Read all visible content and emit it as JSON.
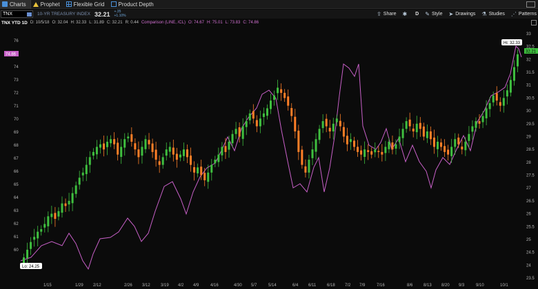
{
  "tabs": [
    {
      "label": "Charts",
      "icon": "charts-icon",
      "active": true
    },
    {
      "label": "Prophet",
      "icon": "prophet-icon",
      "active": false
    },
    {
      "label": "Flexible Grid",
      "icon": "grid-icon",
      "active": false
    },
    {
      "label": "Product Depth",
      "icon": "depth-icon",
      "active": false
    }
  ],
  "toolbar": {
    "symbol": "TNX",
    "description": "10-YR TREASURY INDEX",
    "last": "32.21",
    "change": "+.35",
    "change_pct": "+1.10%",
    "share_label": "Share",
    "aggregation": "D",
    "style_label": "Style",
    "drawings_label": "Drawings",
    "studies_label": "Studies",
    "patterns_label": "Patterns"
  },
  "chart_header": {
    "title": "TNX YTD 1D",
    "date": "D: 10/5/18",
    "open": "O: 32.04",
    "high": "H: 32.33",
    "low": "L: 31.89",
    "close": "C: 32.21",
    "range": "R: 0.44",
    "comparison_label": "Comparison (LINE, /CL)",
    "cmp_open": "O: 74.67",
    "cmp_high": "H: 75.01",
    "cmp_low": "L: 73.83",
    "cmp_close": "C: 74.86"
  },
  "chart_data": {
    "type": "candlestick",
    "x_ticks": [
      "1/15",
      "1/29",
      "2/12",
      "2/26",
      "3/12",
      "3/19",
      "4/2",
      "4/9",
      "4/16",
      "4/30",
      "5/7",
      "5/14",
      "6/4",
      "6/11",
      "6/18",
      "7/2",
      "7/9",
      "7/16",
      "8/6",
      "8/13",
      "8/20",
      "9/3",
      "9/10",
      "10/1"
    ],
    "right_axis": {
      "label": "TNX",
      "ticks": [
        "33",
        "32.5",
        "32",
        "31.5",
        "31",
        "30.5",
        "30",
        "29.5",
        "29",
        "28.5",
        "28",
        "27.5",
        "27",
        "26.5",
        "26",
        "25.5",
        "25",
        "24.5",
        "24",
        "23.5"
      ],
      "ylim": [
        23.5,
        33
      ]
    },
    "left_axis": {
      "label": "/CL",
      "ticks": [
        "76",
        "75",
        "74",
        "73",
        "72",
        "71",
        "70",
        "69",
        "68",
        "67",
        "66",
        "65",
        "64",
        "63",
        "62",
        "61",
        "60"
      ],
      "ylim": [
        59,
        76
      ]
    },
    "hi_label": "Hi: 32.33",
    "lo_label": "Lo: 24.25",
    "last_price_tag": "32.21",
    "cmp_price_tag": "74.86",
    "up_color": "#3fbf3f",
    "down_color": "#ff7f27",
    "comparison_color": "#c860c8",
    "tnx_close": [
      24.3,
      24.6,
      24.9,
      25.1,
      25.3,
      25.4,
      25.6,
      25.9,
      26.0,
      25.8,
      26.1,
      26.4,
      26.3,
      26.5,
      26.8,
      27.1,
      27.4,
      27.6,
      27.9,
      28.2,
      28.4,
      28.6,
      28.7,
      28.5,
      28.8,
      28.9,
      28.7,
      28.3,
      28.6,
      28.9,
      29.0,
      28.8,
      28.5,
      28.2,
      28.6,
      28.9,
      28.7,
      28.4,
      28.1,
      27.9,
      28.2,
      28.5,
      28.6,
      28.3,
      28.1,
      28.3,
      28.5,
      28.2,
      27.9,
      27.6,
      27.8,
      27.5,
      27.3,
      27.6,
      27.9,
      28.1,
      28.3,
      28.6,
      28.4,
      28.8,
      29.1,
      29.3,
      29.0,
      29.4,
      29.6,
      29.9,
      29.7,
      29.4,
      29.7,
      29.9,
      30.1,
      30.4,
      30.6,
      30.9,
      30.7,
      30.5,
      30.2,
      29.8,
      29.2,
      28.4,
      27.9,
      27.6,
      28.1,
      28.5,
      28.9,
      29.3,
      29.6,
      29.4,
      29.2,
      29.5,
      29.7,
      29.4,
      29.0,
      28.7,
      28.9,
      28.6,
      28.4,
      28.3,
      28.5,
      28.4,
      28.3,
      28.5,
      28.4,
      28.3,
      28.6,
      28.8,
      28.5,
      28.7,
      29.0,
      29.3,
      29.6,
      29.4,
      29.2,
      29.5,
      29.3,
      29.0,
      29.2,
      28.9,
      28.6,
      28.8,
      28.6,
      28.4,
      28.3,
      28.6,
      28.9,
      28.7,
      28.5,
      28.8,
      29.1,
      29.4,
      29.6,
      29.5,
      29.8,
      30.1,
      30.3,
      30.6,
      30.4,
      30.2,
      30.5,
      30.8,
      31.2,
      31.7,
      32.2
    ]
  }
}
